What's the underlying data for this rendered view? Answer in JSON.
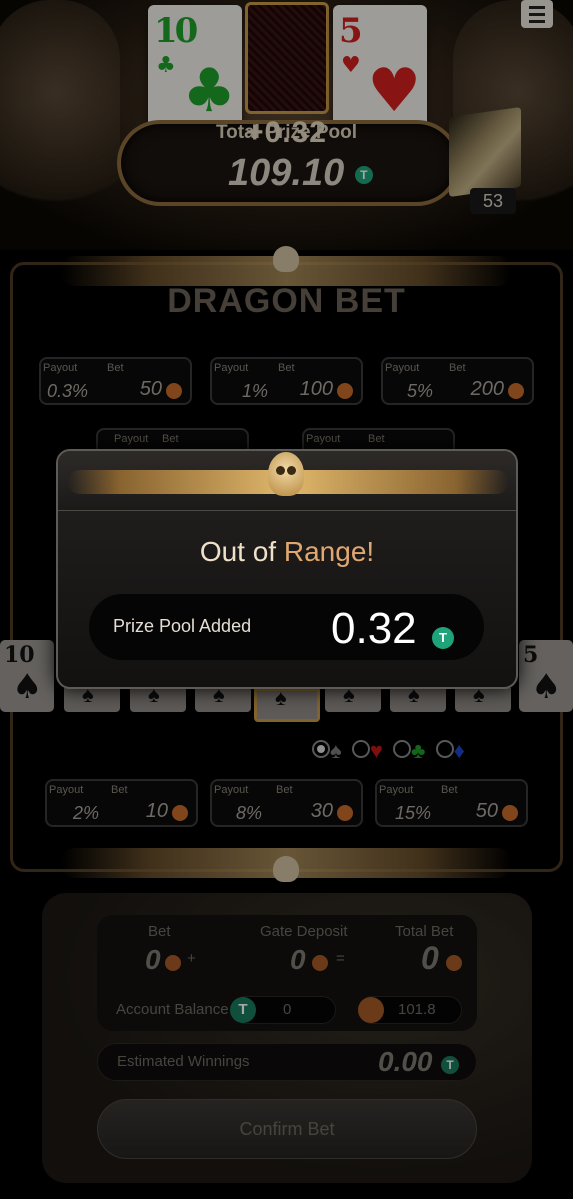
{
  "table": {
    "cards": [
      {
        "rank": "10",
        "suit": "♣",
        "color": "#1fa02a"
      },
      {
        "rank": "5",
        "suit": "♥",
        "color": "#d11f1f"
      }
    ],
    "pool_label": "Total Prize Pool",
    "pool_added": "+0.32",
    "pool_value": "109.10",
    "deck_count": "53"
  },
  "dragon_bet": {
    "title": "DRAGON BET",
    "payout_label": "Payout",
    "bet_label": "Bet",
    "row1": [
      {
        "payout": "0.3%",
        "bet": "50"
      },
      {
        "payout": "1%",
        "bet": "100"
      },
      {
        "payout": "5%",
        "bet": "200"
      }
    ],
    "row3": [
      {
        "payout": "2%",
        "bet": "10"
      },
      {
        "payout": "8%",
        "bet": "30"
      },
      {
        "payout": "15%",
        "bet": "50"
      }
    ],
    "left_card": {
      "rank": "10",
      "suit": "♠"
    },
    "right_card": {
      "rank": "5",
      "suit": "♠"
    },
    "suits": [
      "♠",
      "♥",
      "♣",
      "♦"
    ],
    "selected_suit": "♠"
  },
  "summary": {
    "bet_label": "Bet",
    "bet_value": "0",
    "plus": "+",
    "gate_label": "Gate Deposit",
    "gate_value": "0",
    "equals": "=",
    "total_label": "Total Bet",
    "total_value": "0",
    "balance_label": "Account Balance",
    "balance_t": "0",
    "balance_o": "101.8",
    "est_label": "Estimated Winnings",
    "est_value": "0.00",
    "confirm": "Confirm Bet"
  },
  "modal": {
    "title_a": "Out of ",
    "title_b": "Range!",
    "label": "Prize Pool Added",
    "value": "0.32",
    "coin_symbol": "T"
  }
}
